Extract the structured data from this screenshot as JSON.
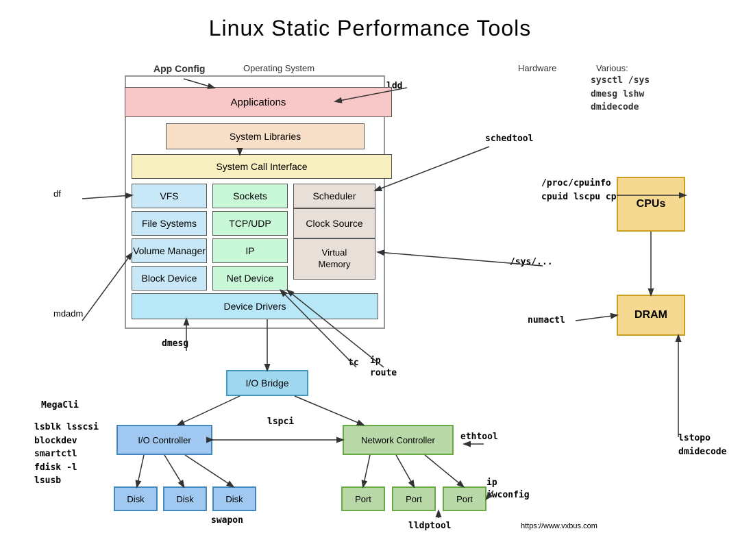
{
  "title": "Linux Static Performance Tools",
  "categories": {
    "app_config": "App Config",
    "operating_system": "Operating System",
    "hardware": "Hardware",
    "various": "Various:"
  },
  "various_tools": "sysctl /sys\ndmesg lshw\ndmidecode",
  "tools": {
    "ldd": "ldd",
    "schedtool": "schedtool",
    "df": "df",
    "proc_cpuinfo": "/proc/cpuinfo\ncpuid lscpu cpu-x",
    "sys_dots": "/sys/...",
    "numactl": "numactl",
    "mdadm": "mdadm",
    "dmesg": "dmesg",
    "tc": "tc",
    "ip_route": "ip\nroute",
    "megacli": "MegaCli",
    "lsblk": "lsblk lsscsi\nblockdev\nsmartctl\nfdisk -l\nlsusb",
    "lspci": "lspci",
    "ethtool": "ethtool",
    "lstopo": "lstopo\ndmidecode",
    "swapon": "swapon",
    "ip_iwconfig": "ip\niwconfig",
    "lldptool": "lldptool",
    "website": "https://www.vxbus.com"
  },
  "boxes": {
    "applications": "Applications",
    "system_libraries": "System Libraries",
    "system_call_interface": "System Call Interface",
    "vfs": "VFS",
    "sockets": "Sockets",
    "scheduler": "Scheduler",
    "file_systems": "File Systems",
    "tcp_udp": "TCP/UDP",
    "clock_source": "Clock Source",
    "volume_manager": "Volume Manager",
    "ip": "IP",
    "virtual_memory": "Virtual\nMemory",
    "block_device": "Block Device",
    "net_device": "Net Device",
    "device_drivers": "Device Drivers",
    "io_bridge": "I/O Bridge",
    "io_controller": "I/O Controller",
    "network_controller": "Network Controller",
    "disk": "Disk",
    "port": "Port",
    "cpus": "CPUs",
    "dram": "DRAM"
  }
}
